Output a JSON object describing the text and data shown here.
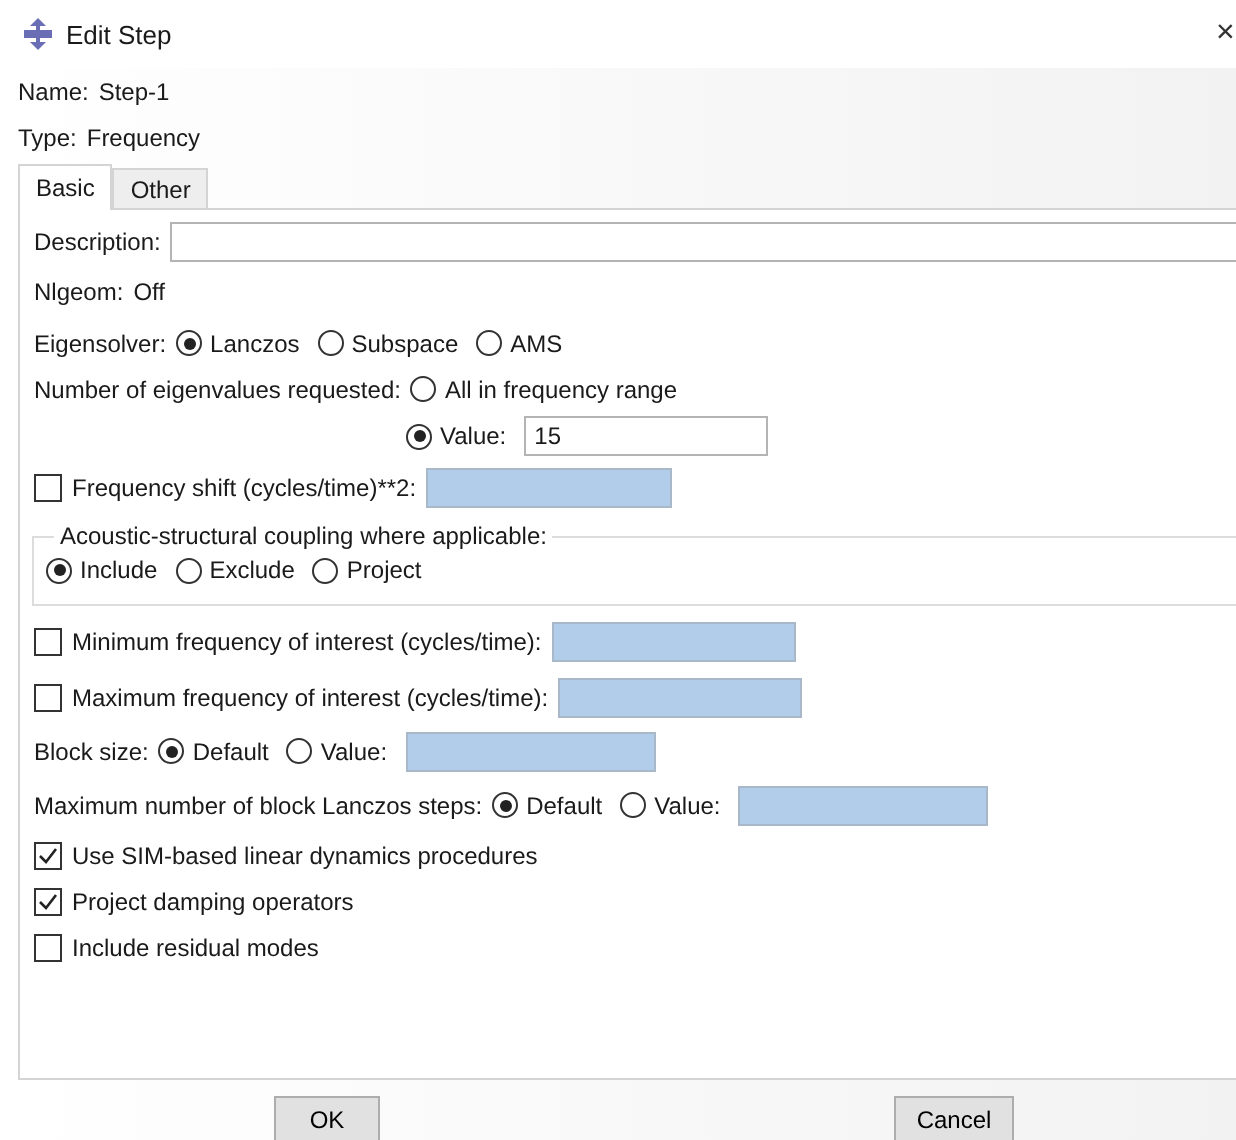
{
  "window": {
    "title": "Edit Step",
    "close": "×"
  },
  "name": {
    "label": "Name:",
    "value": "Step-1"
  },
  "type": {
    "label": "Type:",
    "value": "Frequency"
  },
  "tabs": [
    {
      "label": "Basic",
      "selected": true
    },
    {
      "label": "Other",
      "selected": false
    }
  ],
  "description": {
    "label": "Description:"
  },
  "nlgeom": {
    "label": "Nlgeom:",
    "value": "Off"
  },
  "eigensolver": {
    "label": "Eigensolver:",
    "options": [
      {
        "label": "Lanczos",
        "selected": true
      },
      {
        "label": "Subspace",
        "selected": false
      },
      {
        "label": "AMS",
        "selected": false
      }
    ]
  },
  "eigenvalues": {
    "label": "Number of eigenvalues requested:",
    "options": [
      {
        "label": "All in frequency range",
        "selected": false
      },
      {
        "label": "Value:",
        "selected": true
      }
    ],
    "value": "15"
  },
  "frequency_shift": {
    "label": "Frequency shift (cycles/time)**2:",
    "checked": false,
    "disabled": true
  },
  "coupling": {
    "title": "Acoustic-structural coupling where applicable:",
    "options": [
      {
        "label": "Include",
        "selected": true
      },
      {
        "label": "Exclude",
        "selected": false
      },
      {
        "label": "Project",
        "selected": false
      }
    ]
  },
  "min_frequency": {
    "label": "Minimum frequency of interest (cycles/time):",
    "checked": false,
    "disabled": true
  },
  "max_frequency": {
    "label": "Maximum frequency of interest (cycles/time):",
    "checked": false,
    "disabled": true
  },
  "block_size": {
    "label": "Block size:",
    "options": [
      {
        "label": "Default",
        "selected": true
      },
      {
        "label": "Value:",
        "selected": false
      }
    ],
    "disabled": true
  },
  "lanczos_steps": {
    "label": "Maximum number of block Lanczos steps:",
    "options": [
      {
        "label": "Default",
        "selected": true
      },
      {
        "label": "Value:",
        "selected": false
      }
    ],
    "disabled": true
  },
  "options": [
    {
      "label": "Use SIM-based linear dynamics procedures",
      "checked": true
    },
    {
      "label": "Project damping operators",
      "checked": true
    },
    {
      "label": "Include residual modes",
      "checked": false
    }
  ],
  "buttons": [
    "OK",
    "Cancel"
  ]
}
